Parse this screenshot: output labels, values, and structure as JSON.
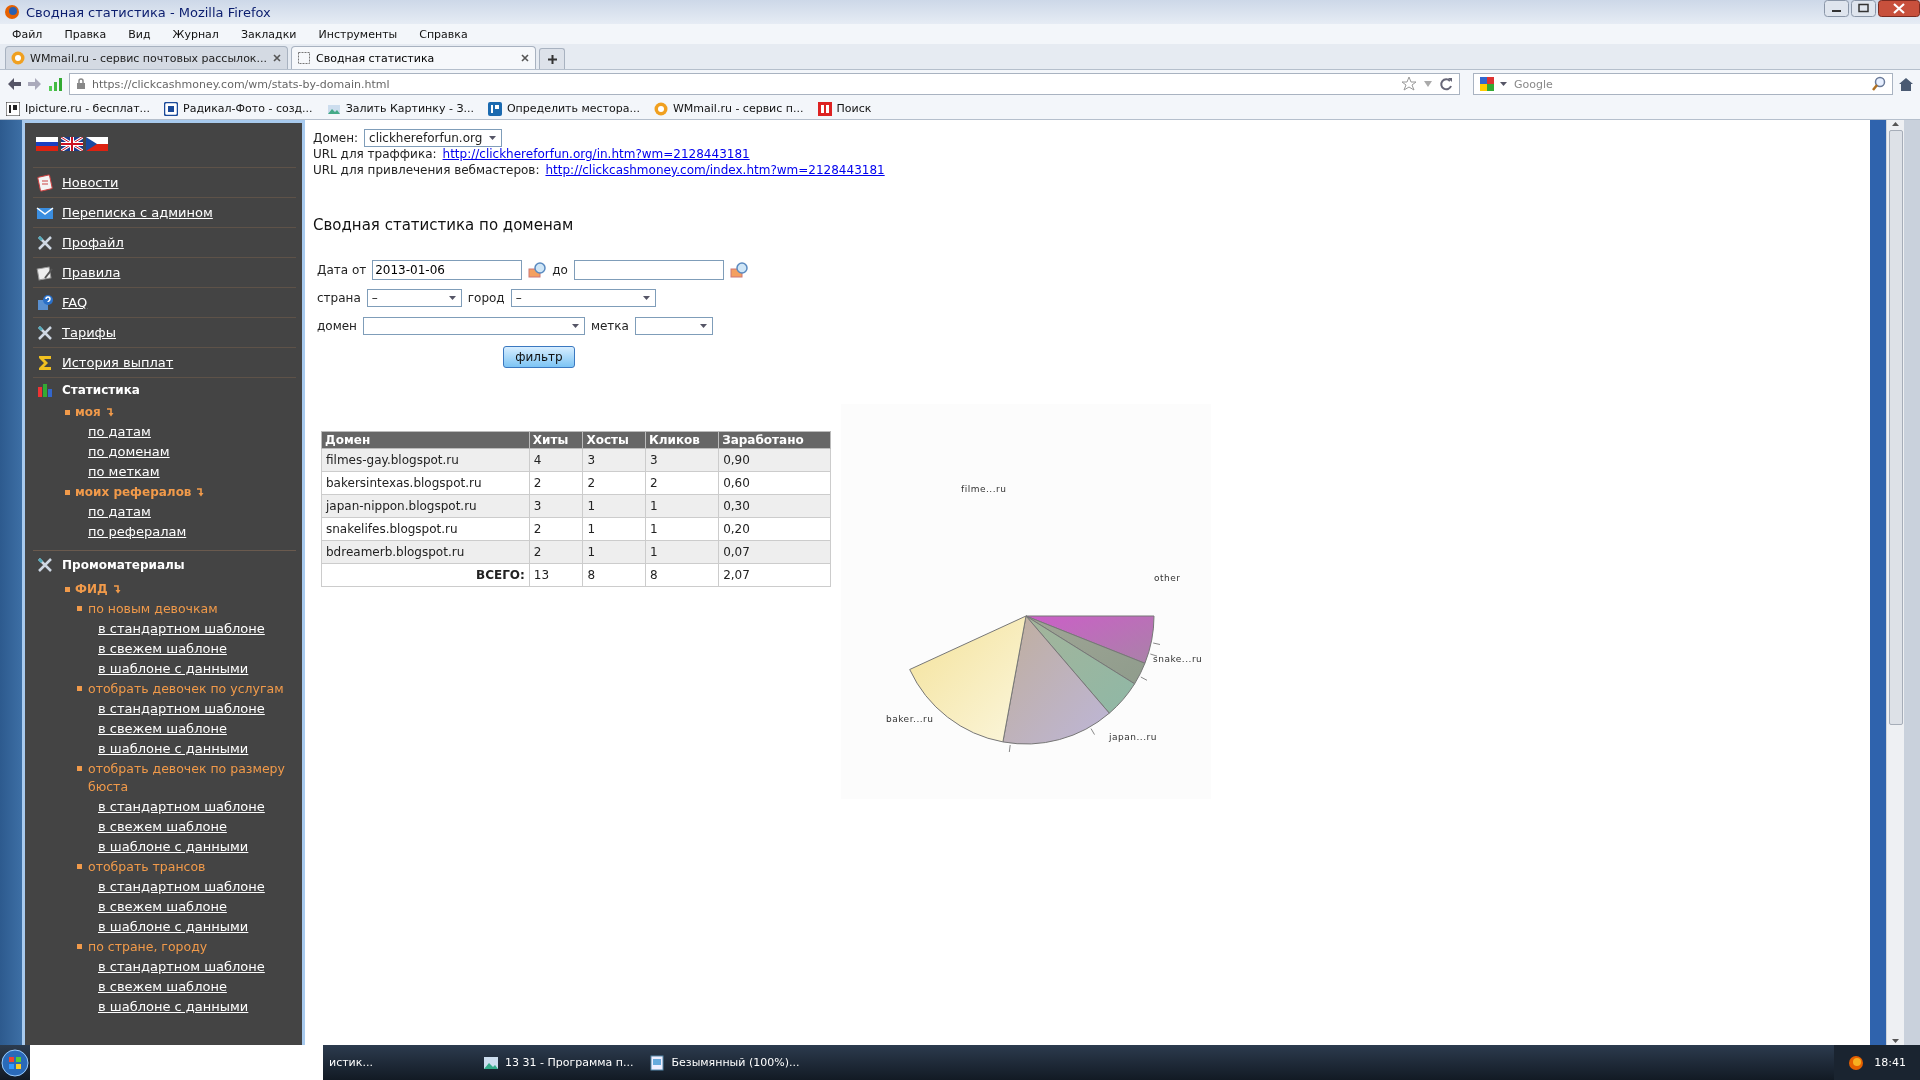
{
  "window": {
    "title": "Сводная статистика - Mozilla Firefox"
  },
  "menu": [
    "Файл",
    "Правка",
    "Вид",
    "Журнал",
    "Закладки",
    "Инструменты",
    "Справка"
  ],
  "tabs": [
    {
      "label": "WMmail.ru - сервис почтовых рассылок...",
      "selected": false
    },
    {
      "label": "Сводная статистика",
      "selected": true
    }
  ],
  "address": "https://clickcashmoney.com/wm/stats-by-domain.html",
  "search": {
    "placeholder": "Google"
  },
  "bookmarks": [
    "Ipicture.ru - бесплат...",
    "Радикал-Фото - созд...",
    "Залить Картинку - З...",
    "Определить местора...",
    "WMmail.ru - сервис п...",
    "Поиск"
  ],
  "sidebar": {
    "links": [
      "Новости",
      "Переписка с админом",
      "Профайл",
      "Правила",
      "FAQ",
      "Тарифы",
      "История выплат"
    ],
    "sections": [
      {
        "title": "Статистика",
        "children": [
          {
            "label": "моя",
            "children": [
              {
                "label": "по датам"
              },
              {
                "label": "по доменам"
              },
              {
                "label": "по меткам"
              }
            ]
          },
          {
            "label": "моих рефералов",
            "children": [
              {
                "label": "по датам"
              },
              {
                "label": "по рефералам"
              }
            ]
          }
        ]
      },
      {
        "title": "Промоматериалы",
        "children": [
          {
            "label": "ФИД",
            "children": [
              {
                "label": "по новым девочкам",
                "children": [
                  {
                    "label": "в стандартном шаблоне"
                  },
                  {
                    "label": "в свежем шаблоне"
                  },
                  {
                    "label": "в шаблоне с данными"
                  }
                ]
              },
              {
                "label": "отобрать девочек по услугам",
                "children": [
                  {
                    "label": "в стандартном шаблоне"
                  },
                  {
                    "label": "в свежем шаблоне"
                  },
                  {
                    "label": "в шаблоне с данными"
                  }
                ]
              },
              {
                "label": "отобрать девочек по размеру бюста",
                "children": [
                  {
                    "label": "в стандартном шаблоне"
                  },
                  {
                    "label": "в свежем шаблоне"
                  },
                  {
                    "label": "в шаблоне с данными"
                  }
                ]
              },
              {
                "label": "отобрать трансов",
                "children": [
                  {
                    "label": "в стандартном шаблоне"
                  },
                  {
                    "label": "в свежем шаблоне"
                  },
                  {
                    "label": "в шаблоне с данными"
                  }
                ]
              },
              {
                "label": "по стране, городу",
                "children": [
                  {
                    "label": "в стандартном шаблоне"
                  },
                  {
                    "label": "в свежем шаблоне"
                  },
                  {
                    "label": "в шаблоне с данными"
                  }
                ]
              }
            ]
          }
        ]
      }
    ]
  },
  "page": {
    "domain_label": "Домен:",
    "domain": "clickhereforfun.org",
    "traffic_label": "URL для траффика:",
    "traffic_url": "http://clickhereforfun.org/in.htm?wm=2128443181",
    "webmasters_label": "URL для привлечения вебмастеров:",
    "webmasters_url": "http://clickcashmoney.com/index.htm?wm=2128443181",
    "heading": "Сводная статистика по доменам",
    "filter": {
      "date_from_label": "Дата от",
      "date_from": "2013-01-06",
      "date_to_label": "до",
      "country_label": "страна",
      "country": "–",
      "city_label": "город",
      "city": "–",
      "domain_label": "домен",
      "tag_label": "метка",
      "button": "фильтр"
    },
    "table": {
      "columns": [
        "Домен",
        "Хиты",
        "Хосты",
        "Кликов",
        "Заработано"
      ],
      "rows": [
        [
          "filmes-gay.blogspot.ru",
          "4",
          "3",
          "3",
          "0,90"
        ],
        [
          "bakersintexas.blogspot.ru",
          "2",
          "2",
          "2",
          "0,60"
        ],
        [
          "japan-nippon.blogspot.ru",
          "3",
          "1",
          "1",
          "0,30"
        ],
        [
          "snakelifes.blogspot.ru",
          "2",
          "1",
          "1",
          "0,20"
        ],
        [
          "bdreamerb.blogspot.ru",
          "2",
          "1",
          "1",
          "0,07"
        ]
      ],
      "total": {
        "label": "ВСЕГО:",
        "values": [
          "13",
          "8",
          "8",
          "2,07"
        ]
      }
    },
    "chart": {
      "labels": [
        "filme...ru",
        "other",
        "snake...ru",
        "baker...ru",
        "japan...ru"
      ]
    }
  },
  "taskbar": {
    "items": [
      "истик...",
      "13 31 - Программа п...",
      "Безымянный (100%)..."
    ],
    "clock": "18:41"
  }
}
